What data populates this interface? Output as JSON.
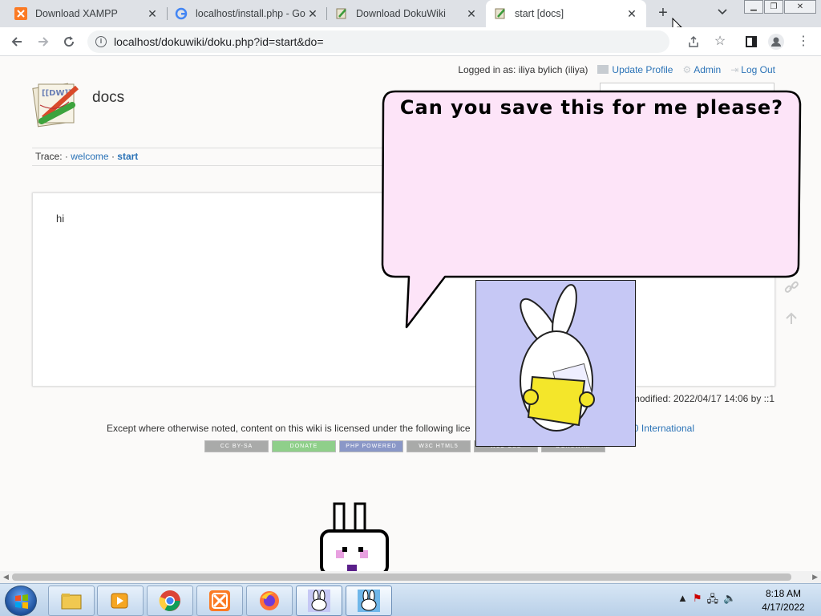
{
  "browser": {
    "tabs": [
      {
        "title": "Download XAMPP",
        "icon": "xampp-icon"
      },
      {
        "title": "localhost/install.php - Go",
        "icon": "google-icon"
      },
      {
        "title": "Download DokuWiki",
        "icon": "dokuwiki-icon"
      },
      {
        "title": "start [docs]",
        "icon": "dokuwiki-icon",
        "active": true
      }
    ],
    "new_tab_label": "+",
    "tab_list_label": "⌄",
    "url": "localhost/dokuwiki/doku.php?id=start&do="
  },
  "wiki": {
    "logged_in_label": "Logged in as: iliya bylich (iliya)",
    "update_profile": "Update Profile",
    "admin": "Admin",
    "logout": "Log Out",
    "site_title": "docs",
    "trace_label": "Trace:",
    "trace_sep": "·",
    "trace_items": [
      "welcome",
      "start"
    ],
    "content_text": "hi",
    "last_modified": "modified: 2022/04/17 14:06 by ::1",
    "license_text": "Except where otherwise noted, content on this wiki is licensed under the following lice",
    "license_link": ".0 International",
    "badges": [
      {
        "label": "CC BY-SA",
        "color": "#a9aaa9"
      },
      {
        "label": "DONATE",
        "color": "#8fcf8a"
      },
      {
        "label": "PHP POWERED",
        "color": "#8a97c7"
      },
      {
        "label": "W3C HTML5",
        "color": "#a9aaa9"
      },
      {
        "label": "W3C CSS",
        "color": "#a9aaa9"
      },
      {
        "label": "DOKUWIKI",
        "color": "#a9aaa9"
      }
    ]
  },
  "overlay": {
    "bubble_text": "Can you save this for me please?",
    "bubble_fill": "#fde4f8"
  },
  "taskbar": {
    "apps": [
      "explorer",
      "media-player",
      "chrome",
      "xampp",
      "firefox",
      "bunny-app",
      "bunny-app-2"
    ],
    "time": "8:18 AM",
    "date": "4/17/2022"
  }
}
